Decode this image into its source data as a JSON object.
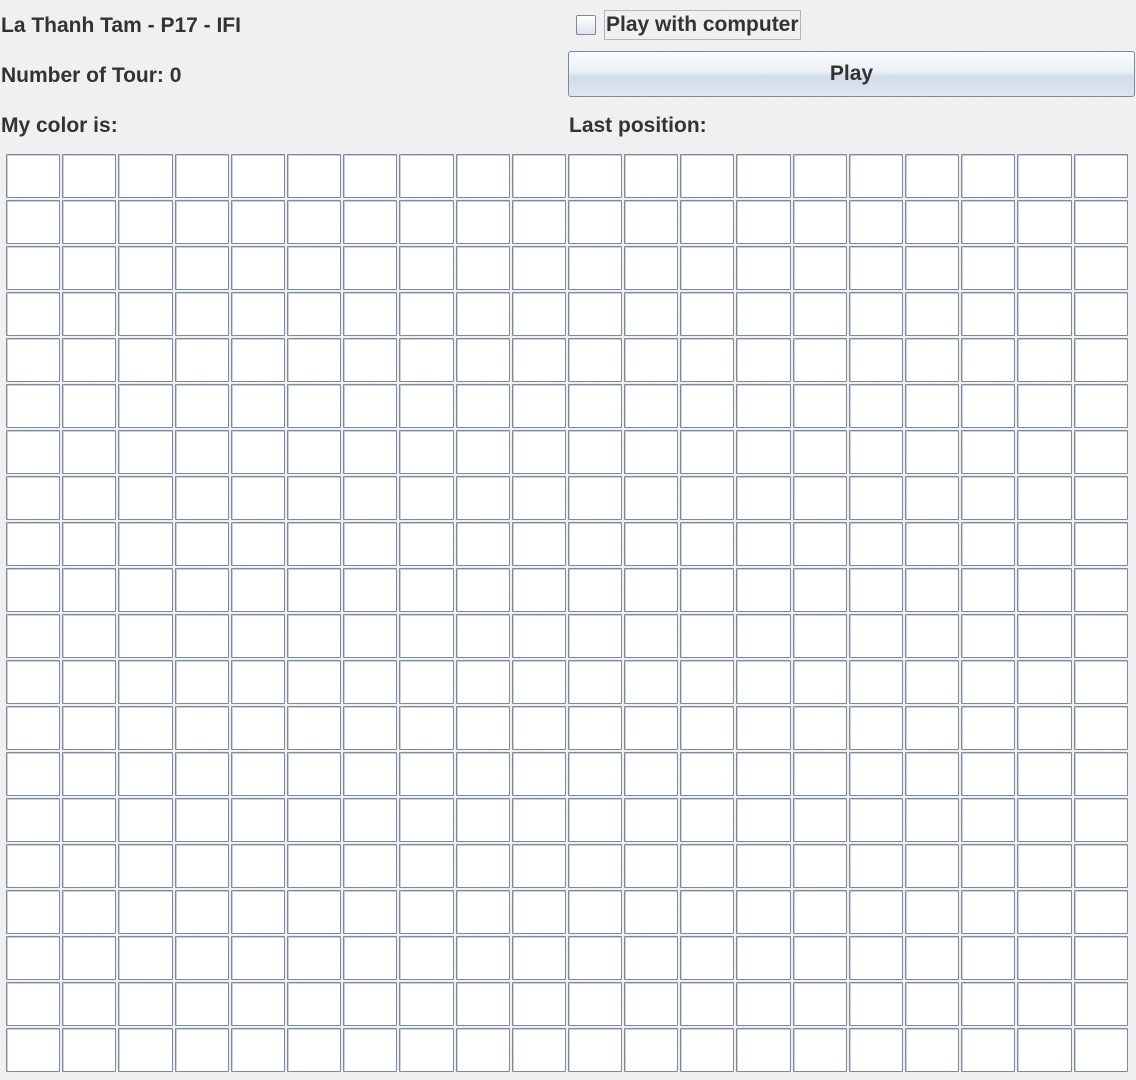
{
  "header": {
    "title": "La Thanh Tam - P17 - IFI",
    "tour_label": "Number of Tour:",
    "tour_count": 0,
    "color_label": "My color is:",
    "last_position_label": "Last position:"
  },
  "controls": {
    "play_with_computer_label": "Play with computer",
    "play_with_computer_checked": false,
    "play_button_label": "Play"
  },
  "board": {
    "rows": 20,
    "columns": 20,
    "occupied_cells": []
  },
  "colors": {
    "background": "#eeeeee",
    "text": "#333333",
    "cell_border": "#7c8a9c",
    "cell_fill": "#ffffff"
  }
}
